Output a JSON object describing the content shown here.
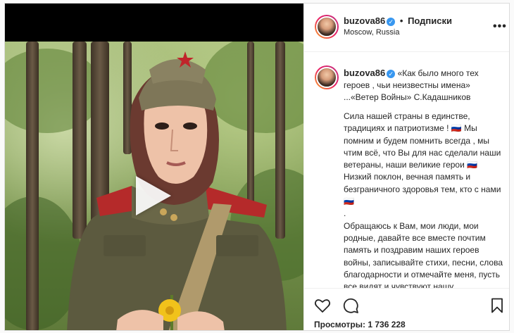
{
  "post": {
    "username": "buzova86",
    "follow_separator": "•",
    "follow_label": "Подписки",
    "location": "Moscow, Russia",
    "more_icon": "more-horizontal-icon",
    "caption_first": "«Как было много тех героев , чьи неизвестны имена» ...«Ветер Войны» С.Кадашников",
    "caption_body": "Сила нашей страны в единстве, традициях и патриотизме ! 🇷🇺 Мы помним и будем помнить всегда , мы чтим всё, что Вы для нас сделали наши ветераны, наши великие герои 🇷🇺 Низкий поклон, вечная память и безграничного здоровья тем, кто с нами 🇷🇺\n.\nОбращаюсь к Вам, мои люди, мои родные, давайте все вместе почтим память и поздравим наших героев войны, записывайте стихи, песни, слова благодарности и отмечайте меня, пусть все видят и чувствуют нашу благодарность и память 🇷🇺",
    "views_label": "Просмотры: 1 736 228"
  },
  "media": {
    "type": "video",
    "play_icon": "play-icon"
  },
  "actions": {
    "like_icon": "heart-icon",
    "comment_icon": "comment-icon",
    "save_icon": "bookmark-icon"
  },
  "colors": {
    "verified": "#3897f0",
    "border": "#dbdbdb",
    "text": "#262626"
  }
}
